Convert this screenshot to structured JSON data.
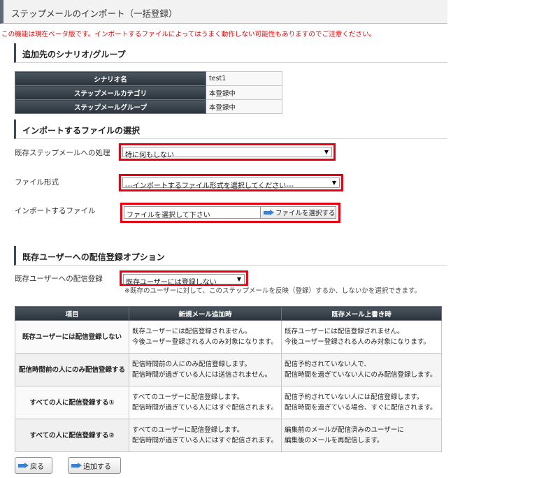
{
  "page": {
    "title": "ステップメールのインポート（一括登録）",
    "warning": "この機能は現在ベータ版です。インポートするファイルによってはうまく動作しない可能性もありますのでご注意ください。"
  },
  "sections": {
    "target": "追加先のシナリオ/グループ",
    "file": "インポートするファイルの選択",
    "options": "既存ユーザーへの配信登録オプション"
  },
  "target_info": [
    {
      "label": "シナリオ名",
      "value": "test1"
    },
    {
      "label": "ステップメールカテゴリ",
      "value": "本登録中"
    },
    {
      "label": "ステップメールグループ",
      "value": "本登録中"
    }
  ],
  "file_form": {
    "existing_label": "既存ステップメールへの処理",
    "existing_value": "特に何もしない",
    "format_label": "ファイル形式",
    "format_value": "---インポートするファイル形式を選択してください---",
    "file_label": "インポートするファイル",
    "file_placeholder": "ファイルを選択して下さい",
    "file_button": "ファイルを選択する"
  },
  "delivery_option": {
    "label": "既存ユーザーへの配信登録",
    "value": "既存ユーザーには登録しない",
    "hint": "※既存のユーザーに対して、このステップメールを反映（登録）するか、しないかを選択できます。"
  },
  "options_table": {
    "headers": [
      "項目",
      "新規メール追加時",
      "既存メール上書き時"
    ],
    "rows": [
      {
        "item": "既存ユーザーには配信登録しない",
        "new": [
          "既存ユーザーには配信登録されません。",
          "今後ユーザー登録される人のみ対象になります。"
        ],
        "overwrite": [
          "既存ユーザーには配信登録されません。",
          "今後ユーザー登録される人のみ対象になります。"
        ]
      },
      {
        "item": "配信時間前の人にのみ配信登録する",
        "new": [
          "配信時間前の人にのみ配信登録します。",
          "配信時間が過ぎている人には送信されません。"
        ],
        "overwrite": [
          "配信予約されていない人で、",
          "配信時間を過ぎていない人にのみ配信登録します。"
        ]
      },
      {
        "item": "すべての人に配信登録する①",
        "new": [
          "すべてのユーザーに配信登録します。",
          "配信時間が過ぎている人にはすぐ配信されます。"
        ],
        "overwrite": [
          "配信予約されていない人には配信登録します。",
          "配信時間を過ぎている場合、すぐに配信されます。"
        ]
      },
      {
        "item": "すべての人に配信登録する②",
        "new": [
          "すべてのユーザーに配信登録します。",
          "配信時間が過ぎている人にはすぐ配信されます。"
        ],
        "overwrite": [
          "編集前のメールが配信済みのユーザーに",
          "編集後のメールを再配信します。"
        ]
      }
    ]
  },
  "buttons": {
    "back": "戻る",
    "add": "追加する"
  },
  "colors": {
    "warning": "#e60000",
    "highlight_border": "#e60012",
    "header_dark": "#2b333b",
    "arrow_blue": "#3a7fd0"
  }
}
